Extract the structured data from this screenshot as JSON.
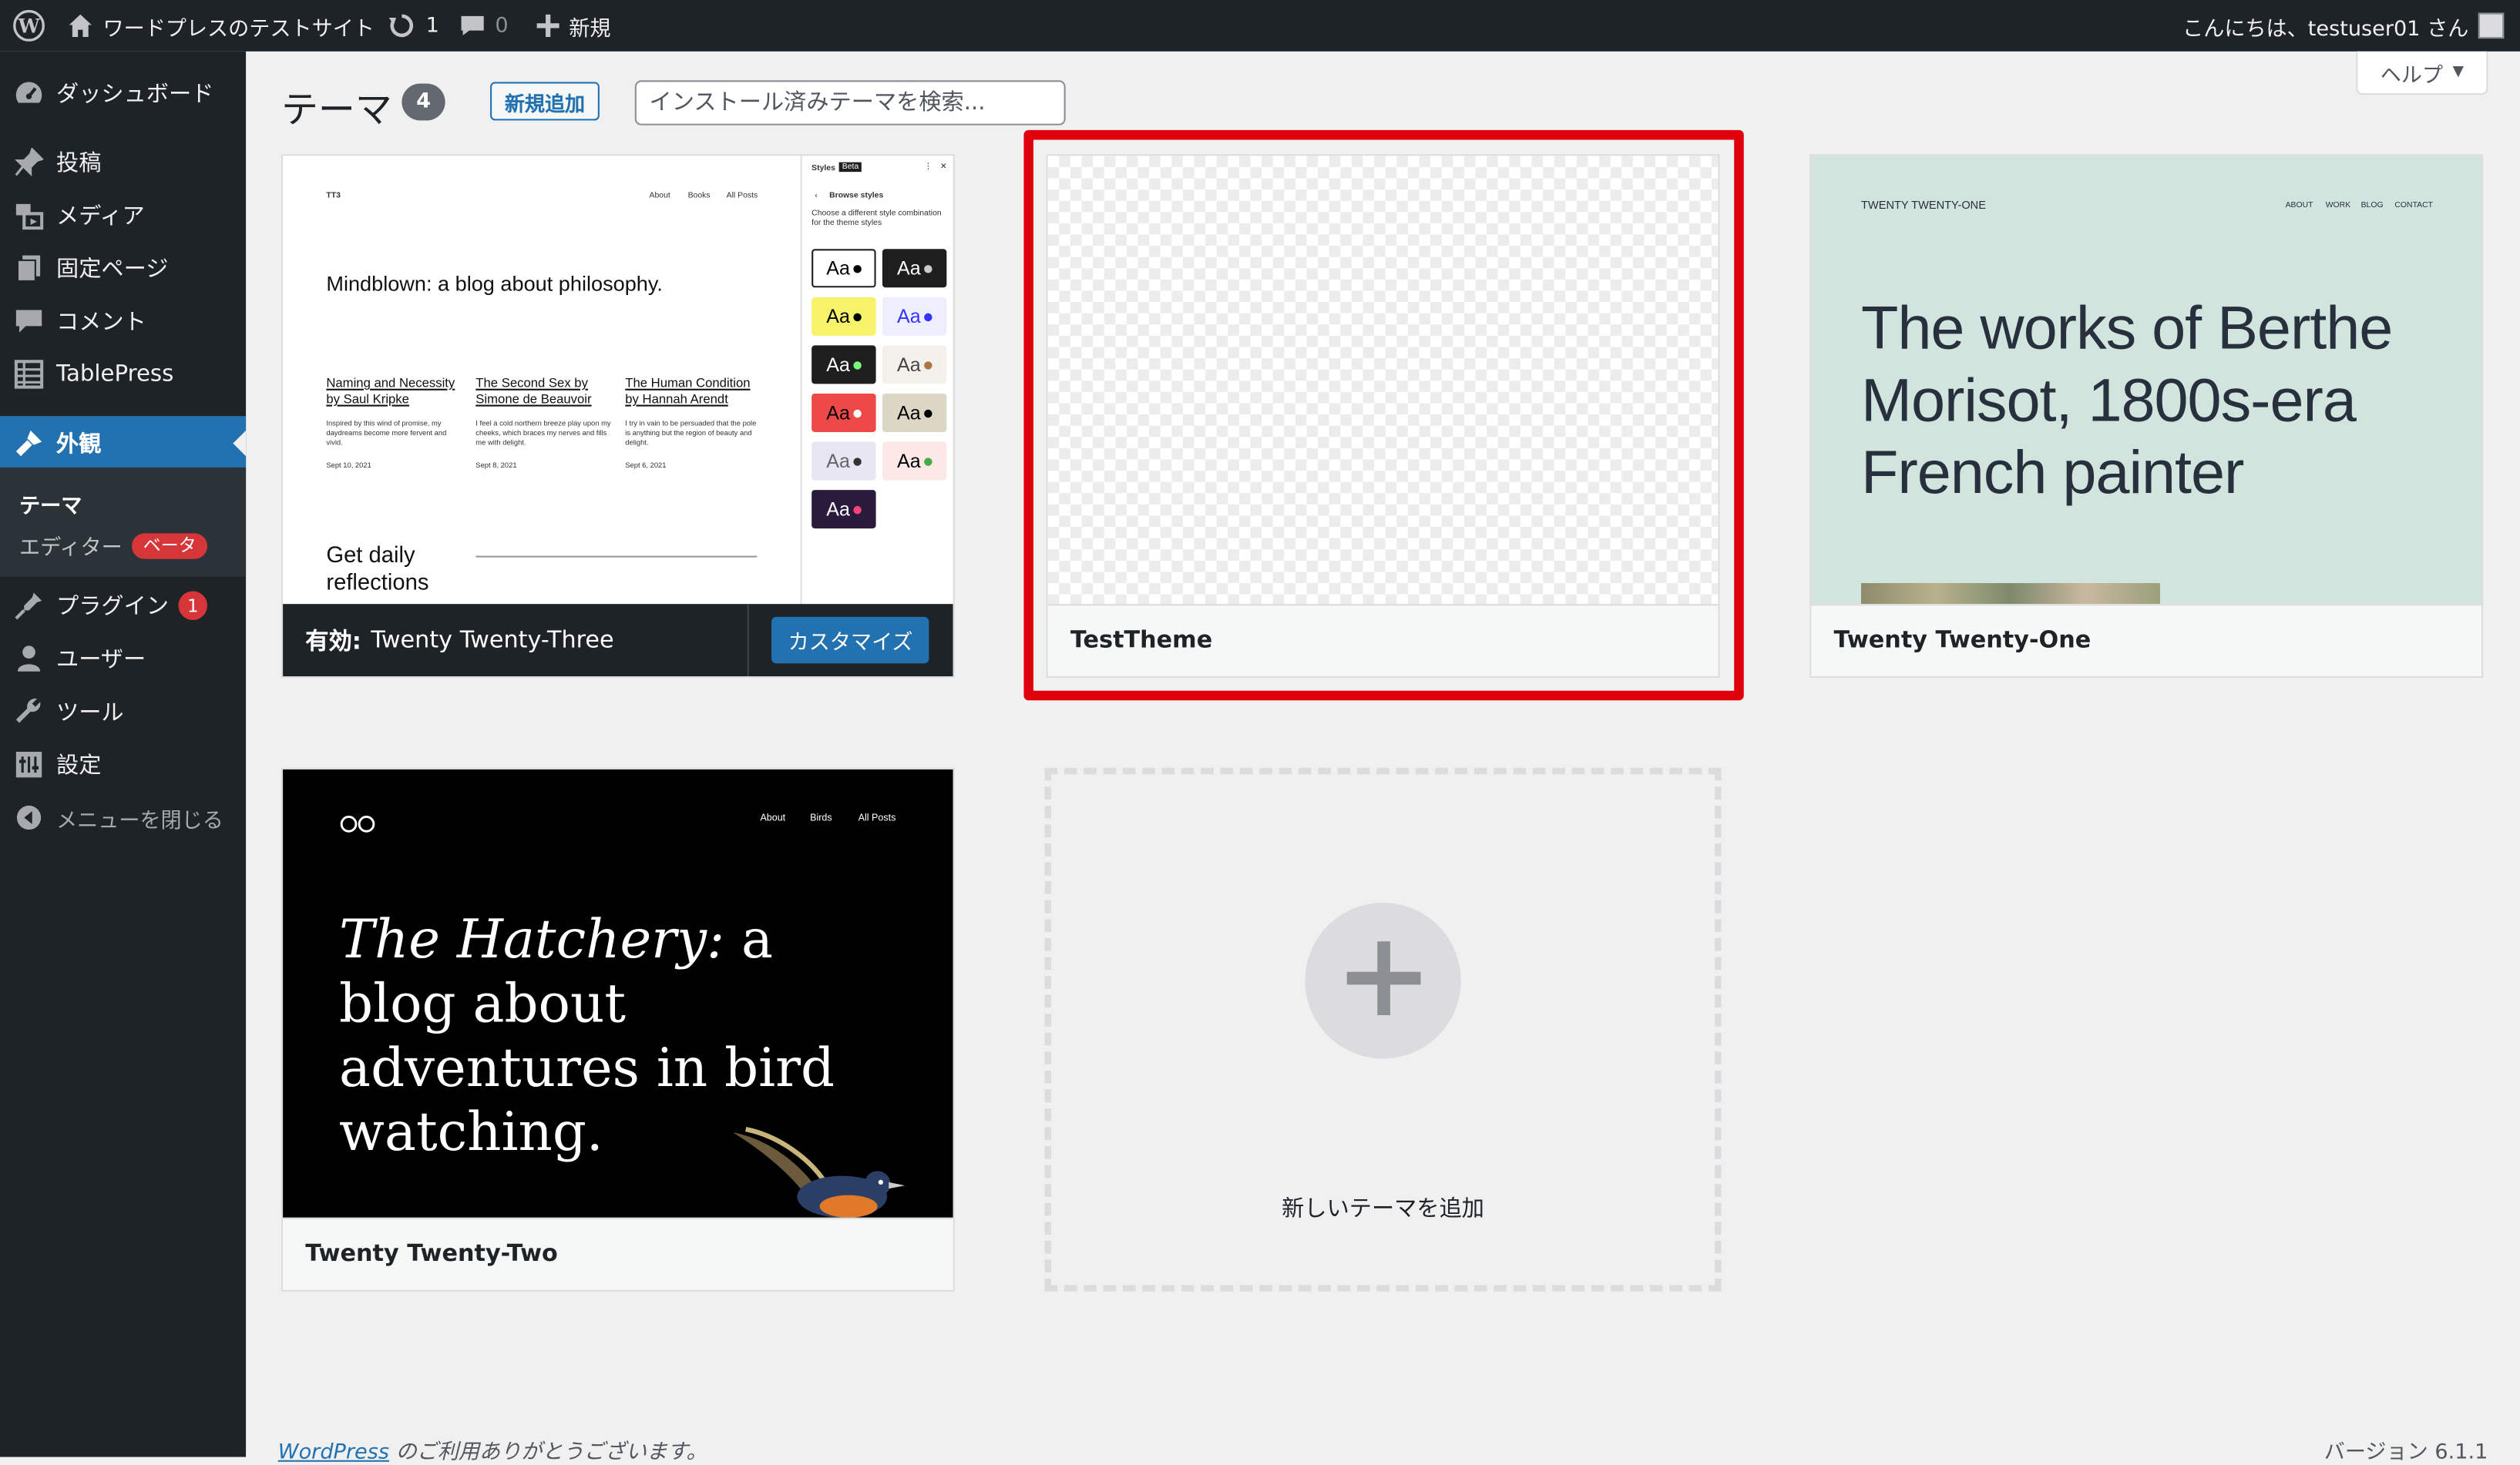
{
  "adminbar": {
    "site_name": "ワードプレスのテストサイト",
    "updates_count": "1",
    "comments_count": "0",
    "new_label": "新規",
    "greeting": "こんにちは、testuser01 さん"
  },
  "sidebar": {
    "items": [
      {
        "label": "ダッシュボード",
        "icon": "dashboard-icon"
      },
      {
        "label": "投稿",
        "icon": "pin-icon"
      },
      {
        "label": "メディア",
        "icon": "media-icon"
      },
      {
        "label": "固定ページ",
        "icon": "page-icon"
      },
      {
        "label": "コメント",
        "icon": "comment-icon"
      },
      {
        "label": "TablePress",
        "icon": "table-icon"
      },
      {
        "label": "外観",
        "icon": "brush-icon"
      },
      {
        "label": "プラグイン",
        "icon": "plugin-icon",
        "count": "1"
      },
      {
        "label": "ユーザー",
        "icon": "user-icon"
      },
      {
        "label": "ツール",
        "icon": "wrench-icon"
      },
      {
        "label": "設定",
        "icon": "settings-icon"
      },
      {
        "label": "メニューを閉じる",
        "icon": "collapse-icon"
      }
    ],
    "submenu": {
      "themes": "テーマ",
      "editor": "エディター",
      "editor_badge": "ベータ"
    }
  },
  "header": {
    "title": "テーマ",
    "count": "4",
    "add_new": "新規追加",
    "search_placeholder": "インストール済みテーマを検索...",
    "help": "ヘルプ"
  },
  "themes": [
    {
      "name": "Twenty Twenty-Three",
      "active_label": "有効:",
      "customize": "カスタマイズ",
      "preview": {
        "logo": "TT3",
        "nav": [
          "About",
          "Books",
          "All Posts"
        ],
        "headline": "Mindblown: a blog about philosophy.",
        "posts": [
          {
            "title": "Naming and Necessity by Saul Kripke",
            "excerpt": "Inspired by this wind of promise, my daydreams become more fervent and vivid.",
            "date": "Sept 10, 2021"
          },
          {
            "title": "The Second Sex by Simone de Beauvoir",
            "excerpt": "I feel a cold northern breeze play upon my cheeks, which braces my nerves and fills me with delight.",
            "date": "Sept 8, 2021"
          },
          {
            "title": "The Human Condition by Hannah Arendt",
            "excerpt": "I try in vain to be persuaded that the pole is anything but the region of beauty and delight.",
            "date": "Sept 6, 2021"
          }
        ],
        "cta": "Get daily reflections",
        "panel_title": "Styles",
        "panel_badge": "Beta",
        "browse": "Browse styles",
        "panel_desc": "Choose a different style combination for the theme styles",
        "swatch_text": "Aa"
      }
    },
    {
      "name": "TestTheme"
    },
    {
      "name": "Twenty Twenty-One",
      "preview": {
        "site": "TWENTY TWENTY-ONE",
        "nav": [
          "ABOUT",
          "WORK",
          "BLOG",
          "CONTACT"
        ],
        "headline": "The works of Berthe Morisot, 1800s-era French painter"
      }
    },
    {
      "name": "Twenty Twenty-Two",
      "preview": {
        "nav": [
          "About",
          "Birds",
          "All Posts"
        ],
        "headline_em": "The Hatchery:",
        "headline_rest": " a blog about adventures in bird watching."
      }
    }
  ],
  "add_new_theme": "新しいテーマを追加",
  "footer": {
    "wordpress": "WordPress",
    "thanks": " のご利用ありがとうございます。",
    "version": "バージョン 6.1.1"
  },
  "colors": {
    "adminbar_bg": "#1d2327",
    "accent": "#2271b1",
    "highlight": "#e0000b",
    "badge": "#d63638"
  }
}
